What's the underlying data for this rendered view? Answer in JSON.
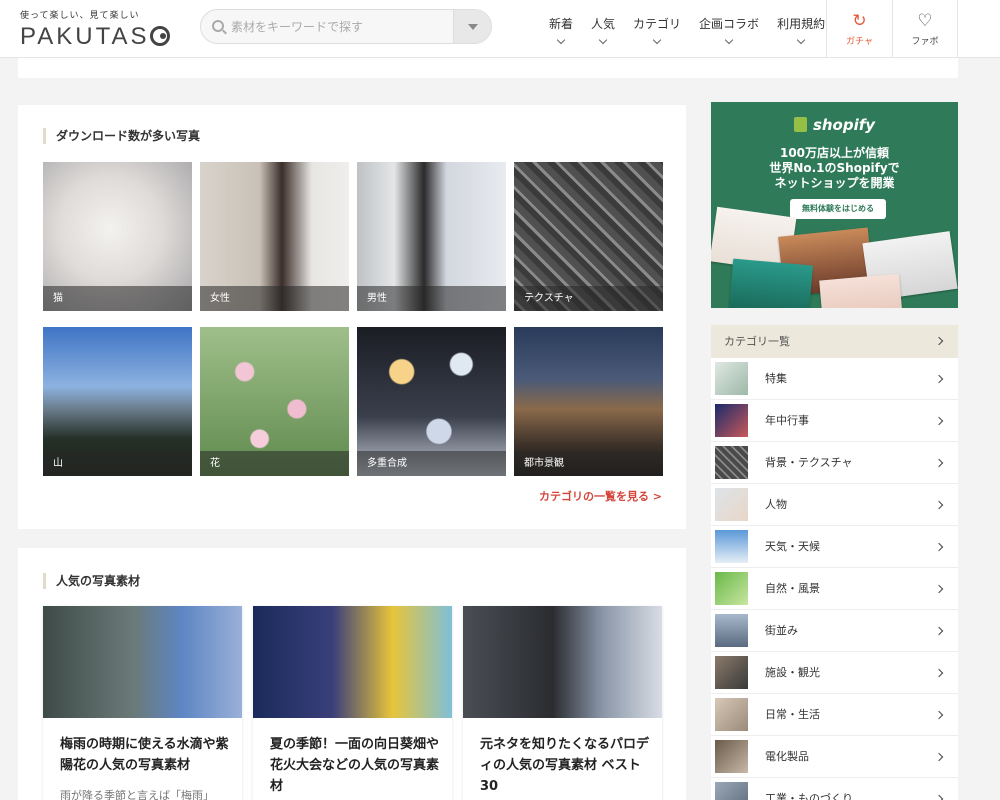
{
  "header": {
    "tagline": "使って楽しい、見て楽しい",
    "logo_text": "PAKUTAS",
    "search_placeholder": "素材をキーワードで探す",
    "nav": [
      {
        "label": "新着"
      },
      {
        "label": "人気"
      },
      {
        "label": "カテゴリ"
      },
      {
        "label": "企画コラボ"
      },
      {
        "label": "利用規約"
      }
    ],
    "gacha_label": "ガチャ",
    "favorite_label": "ファボ"
  },
  "downloads": {
    "title": "ダウンロード数が多い写真",
    "tiles": [
      {
        "label": "猫"
      },
      {
        "label": "女性"
      },
      {
        "label": "男性"
      },
      {
        "label": "テクスチャ"
      },
      {
        "label": "山"
      },
      {
        "label": "花"
      },
      {
        "label": "多重合成"
      },
      {
        "label": "都市景観"
      }
    ],
    "more_link": "カテゴリの一覧を見る >"
  },
  "popular": {
    "title": "人気の写真素材",
    "cards": [
      {
        "title": "梅雨の時期に使える水滴や紫陽花の人気の写真素材",
        "excerpt": "雨が降る季節と言えば「梅雨」"
      },
      {
        "title": "夏の季節！一面の向日葵畑や花火大会などの人気の写真素材",
        "excerpt": ""
      },
      {
        "title": "元ネタを知りたくなるパロディの人気の写真素材 ベスト30",
        "excerpt": ""
      }
    ]
  },
  "ad": {
    "brand": "shopify",
    "line1": "100万店以上が信頼",
    "line2": "世界No.1のShopifyで",
    "line3": "ネットショップを開業",
    "button": "無料体験をはじめる"
  },
  "categories": {
    "title": "カテゴリ一覧",
    "items": [
      {
        "label": "特集"
      },
      {
        "label": "年中行事"
      },
      {
        "label": "背景・テクスチャ"
      },
      {
        "label": "人物"
      },
      {
        "label": "天気・天候"
      },
      {
        "label": "自然・風景"
      },
      {
        "label": "街並み"
      },
      {
        "label": "施設・観光"
      },
      {
        "label": "日常・生活"
      },
      {
        "label": "電化製品"
      },
      {
        "label": "工業・ものづくり"
      }
    ]
  },
  "colors": {
    "accent_red": "#d6453a",
    "ad_green": "#2f7a58",
    "category_header": "#ece8dc"
  }
}
